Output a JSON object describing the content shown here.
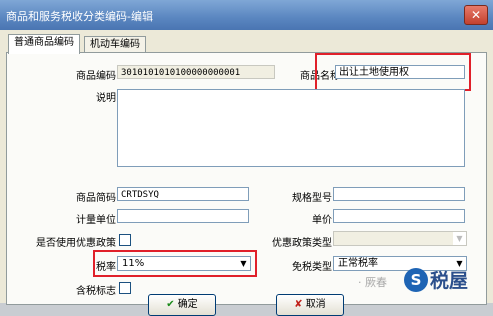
{
  "window": {
    "title": "商品和服务税收分类编码-编辑",
    "close_glyph": "✕"
  },
  "tabs": [
    {
      "label": "普通商品编码"
    },
    {
      "label": "机动车编码"
    }
  ],
  "form": {
    "product_code_label": "商品编码",
    "product_code_value": "3010101010100000000001",
    "product_name_label": "商品名称",
    "product_name_value": "出让土地使用权",
    "description_label": "说明",
    "description_value": "",
    "product_abbr_label": "商品简码",
    "product_abbr_value": "CRTDSYQ",
    "spec_model_label": "规格型号",
    "spec_model_value": "",
    "unit_label": "计量单位",
    "unit_value": "",
    "unit_price_label": "单价",
    "unit_price_value": "",
    "use_preferential_label": "是否使用优惠政策",
    "preferential_type_label": "优惠政策类型",
    "preferential_type_value": "",
    "tax_rate_label": "税率",
    "tax_rate_value": "11%",
    "exempt_type_label": "免税类型",
    "exempt_type_value": "正常税率",
    "tax_included_label": "含税标志"
  },
  "buttons": {
    "save_label": "确定",
    "cancel_label": "取消",
    "save_icon": "✔",
    "cancel_icon": "✘"
  },
  "watermark": {
    "text": "· 厥春",
    "logo_glyph": "S",
    "brand": "税屋"
  },
  "highlight_color": "#e0202a"
}
